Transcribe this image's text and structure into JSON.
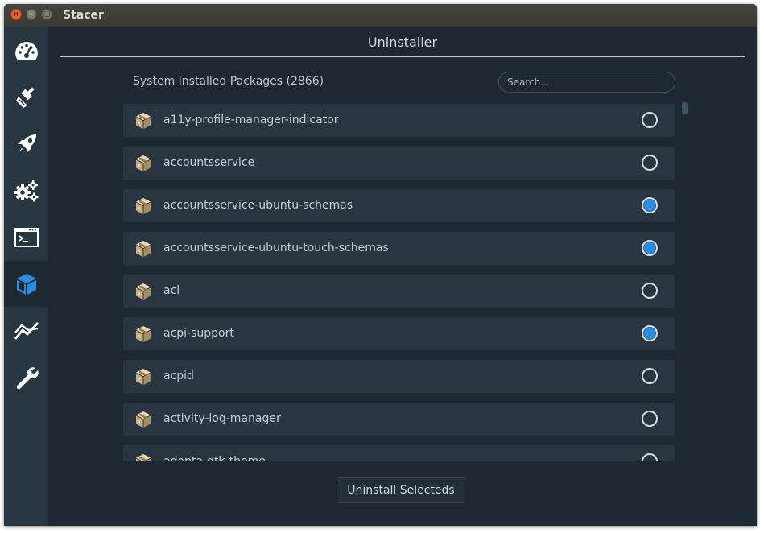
{
  "window": {
    "title": "Stacer",
    "controls": {
      "close": "×",
      "minimize": "–",
      "maximize": "□"
    }
  },
  "sidebar": {
    "items": [
      {
        "name": "dashboard",
        "icon": "speedometer-icon",
        "active": false
      },
      {
        "name": "system-cleaner",
        "icon": "broom-icon",
        "active": false
      },
      {
        "name": "startup-apps",
        "icon": "rocket-icon",
        "active": false
      },
      {
        "name": "services",
        "icon": "gears-icon",
        "active": false
      },
      {
        "name": "processes",
        "icon": "terminal-window-icon",
        "active": false
      },
      {
        "name": "uninstaller",
        "icon": "package-cube-icon",
        "active": true
      },
      {
        "name": "resources",
        "icon": "line-chart-icon",
        "active": false
      },
      {
        "name": "settings",
        "icon": "wrench-icon",
        "active": false
      }
    ]
  },
  "main": {
    "title": "Uninstaller",
    "count_label": "System Installed Packages (2866)",
    "search_placeholder": "Search...",
    "uninstall_button": "Uninstall Selecteds",
    "packages": [
      {
        "name": "a11y-profile-manager-indicator",
        "selected": false
      },
      {
        "name": "accountsservice",
        "selected": false
      },
      {
        "name": "accountsservice-ubuntu-schemas",
        "selected": true
      },
      {
        "name": "accountsservice-ubuntu-touch-schemas",
        "selected": true
      },
      {
        "name": "acl",
        "selected": false
      },
      {
        "name": "acpi-support",
        "selected": true
      },
      {
        "name": "acpid",
        "selected": false
      },
      {
        "name": "activity-log-manager",
        "selected": false
      },
      {
        "name": "adapta-gtk-theme",
        "selected": false
      }
    ]
  },
  "colors": {
    "background": "#1e2832",
    "sidebar": "#283642",
    "row": "#293642",
    "accent": "#2b8ce0",
    "package_icon": "#cdb48a"
  }
}
